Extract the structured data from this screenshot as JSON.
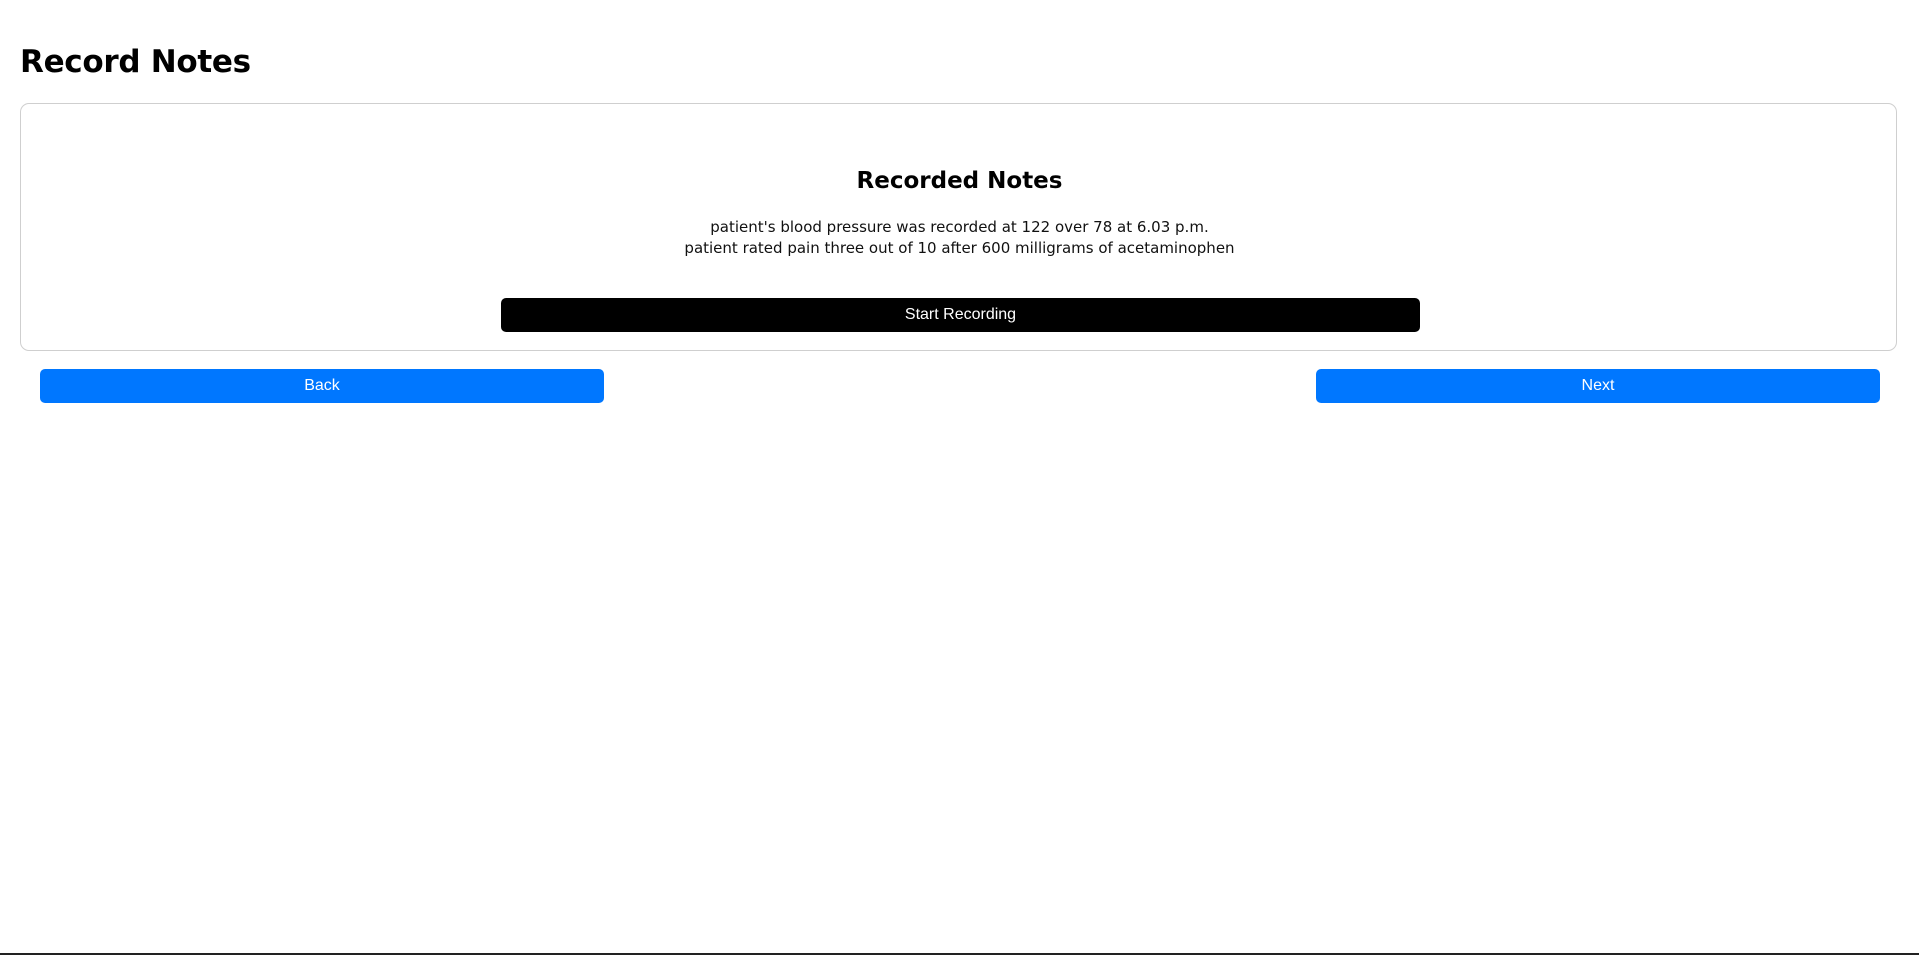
{
  "page": {
    "title": "Record Notes"
  },
  "card": {
    "title": "Recorded Notes",
    "notes": [
      "patient's blood pressure was recorded at 122 over 78 at 6.03 p.m.",
      "patient rated pain three out of 10 after 600 milligrams of acetaminophen"
    ],
    "record_button_label": "Start Recording"
  },
  "navigation": {
    "back_label": "Back",
    "next_label": "Next"
  },
  "colors": {
    "primary": "#0077ff",
    "record_button": "#000000",
    "card_border": "#cfcfcf"
  }
}
